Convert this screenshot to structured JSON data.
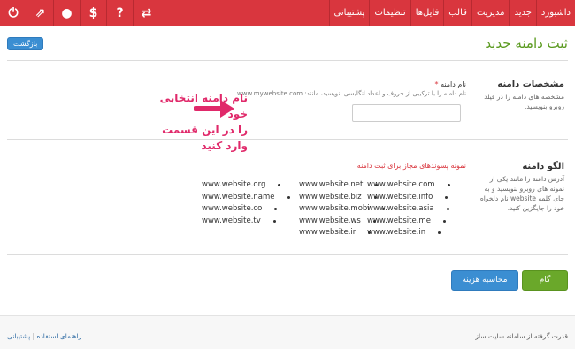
{
  "nav": {
    "items": [
      "داشبورد",
      "جدید",
      "مدیریت",
      "قالب",
      "فایل‌ها",
      "تنظیمات",
      "پشتیبانی"
    ],
    "icons": [
      "power-icon",
      "external-link-icon",
      "user-icon",
      "dollar-icon",
      "help-icon",
      "swap-icon"
    ]
  },
  "header": {
    "title": "ثبت دامنه جدید",
    "back_label": "بازگشت"
  },
  "domain_spec": {
    "title": "مشخصات دامنه",
    "desc": "مشخصه های دامنه را در فیلد روبرو بنویسید.",
    "field_label": "نام دامنه",
    "required_mark": "*",
    "help": "نام دامنه را با ترکیبی از حروف و اعداد انگلیسی بنویسید، مانند: www.mywebsite.com",
    "input_value": ""
  },
  "callout": {
    "line1": "نام دامنه انتخابی خود",
    "line2": "را در این قسمت وارد کنید"
  },
  "pattern": {
    "title": "الگو دامنه",
    "desc": "آدرس دامنه را مانند یکی از نمونه های روبرو بنویسید و به جای کلمه website نام دلخواه خود را جایگزین کنید.",
    "heading": "نمونه پسوندهای مجاز برای ثبت دامنه:",
    "col1": [
      "www.website.com",
      "www.website.info",
      "www.website.asia",
      "www.website.me",
      "www.website.in"
    ],
    "col2": [
      "www.website.net",
      "www.website.biz",
      "www.website.mobi",
      "www.website.ws",
      "www.website.ir"
    ],
    "col3": [
      "www.website.org",
      "www.website.name",
      "www.website.co",
      "www.website.tv"
    ]
  },
  "actions": {
    "next": "گام بعدی",
    "calc": "محاسبه هزینه"
  },
  "footer": {
    "powered": "قدرت گرفته از سامانه سایت ساز",
    "help_link": "راهنمای استفاده",
    "separator": "|",
    "support_link": "پشتیبانی"
  },
  "colors": {
    "topbar": "#d9363e",
    "accent_green": "#6aa82a",
    "accent_blue": "#3b8ed2",
    "callout": "#e0296a"
  }
}
